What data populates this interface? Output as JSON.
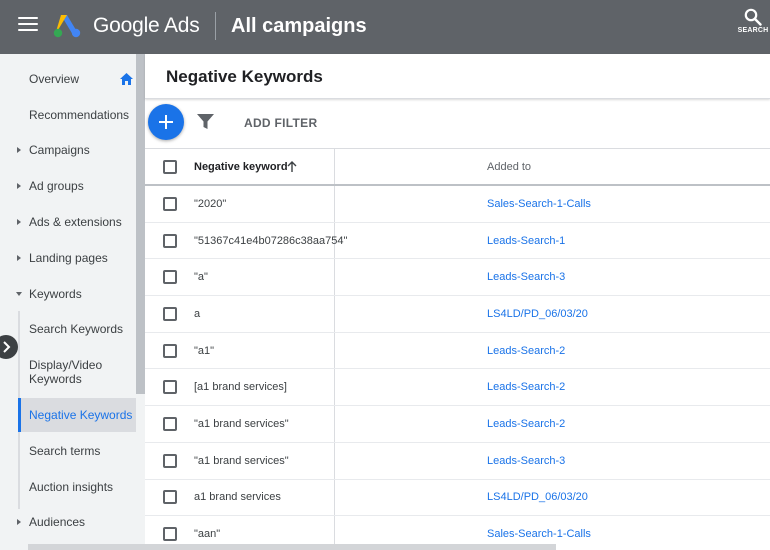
{
  "topbar": {
    "brand": "Google Ads",
    "title": "All campaigns",
    "search_label": "SEARCH"
  },
  "sidebar": {
    "items": [
      {
        "label": "Overview"
      },
      {
        "label": "Recommendations"
      },
      {
        "label": "Campaigns"
      },
      {
        "label": "Ad groups"
      },
      {
        "label": "Ads & extensions"
      },
      {
        "label": "Landing pages"
      },
      {
        "label": "Keywords"
      },
      {
        "label": "Search Keywords"
      },
      {
        "label": "Display/Video Keywords"
      },
      {
        "label": "Negative Keywords"
      },
      {
        "label": "Search terms"
      },
      {
        "label": "Auction insights"
      },
      {
        "label": "Audiences"
      }
    ]
  },
  "page": {
    "title": "Negative Keywords",
    "add_filter": "ADD FILTER"
  },
  "table": {
    "columns": [
      "Negative keyword",
      "Added to"
    ],
    "rows": [
      {
        "keyword": "\"2020\"",
        "added_to": "Sales-Search-1-Calls"
      },
      {
        "keyword": "\"51367c41e4b07286c38aa754\"",
        "added_to": "Leads-Search-1"
      },
      {
        "keyword": "\"a\"",
        "added_to": "Leads-Search-3"
      },
      {
        "keyword": "a",
        "added_to": "LS4LD/PD_06/03/20"
      },
      {
        "keyword": "\"a1\"",
        "added_to": "Leads-Search-2"
      },
      {
        "keyword": "[a1 brand services]",
        "added_to": "Leads-Search-2"
      },
      {
        "keyword": "\"a1 brand services\"",
        "added_to": "Leads-Search-2"
      },
      {
        "keyword": "\"a1 brand services\"",
        "added_to": "Leads-Search-3"
      },
      {
        "keyword": "a1 brand services",
        "added_to": "LS4LD/PD_06/03/20"
      },
      {
        "keyword": "\"aan\"",
        "added_to": "Sales-Search-1-Calls"
      }
    ]
  },
  "colors": {
    "topbar": "#5f6368",
    "accent": "#1a73e8",
    "sidebar_bg": "#f1f3f4"
  },
  "icons": [
    "menu-icon",
    "google-ads-logo",
    "search-icon",
    "home-icon",
    "chevron-right-icon",
    "add-icon",
    "filter-icon",
    "arrow-up-icon"
  ]
}
